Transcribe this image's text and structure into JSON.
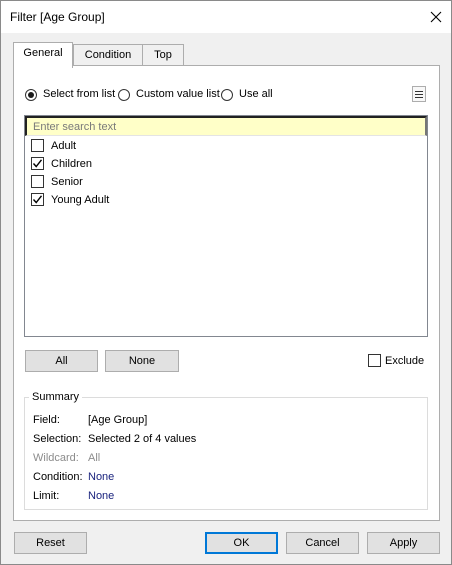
{
  "window": {
    "title": "Filter [Age Group]"
  },
  "tabs": [
    {
      "label": "General",
      "active": true
    },
    {
      "label": "Condition",
      "active": false
    },
    {
      "label": "Top",
      "active": false
    }
  ],
  "mode_options": [
    {
      "label": "Select from list",
      "selected": true
    },
    {
      "label": "Custom value list",
      "selected": false
    },
    {
      "label": "Use all",
      "selected": false
    }
  ],
  "search": {
    "placeholder": "Enter search text",
    "value": ""
  },
  "items": [
    {
      "label": "Adult",
      "checked": false
    },
    {
      "label": "Children",
      "checked": true
    },
    {
      "label": "Senior",
      "checked": false
    },
    {
      "label": "Young Adult",
      "checked": true
    }
  ],
  "list_buttons": {
    "all_label": "All",
    "none_label": "None",
    "exclude_label": "Exclude",
    "exclude_checked": false
  },
  "summary": {
    "title": "Summary",
    "rows": [
      {
        "key": "Field:",
        "value": "[Age Group]"
      },
      {
        "key": "Selection:",
        "value": "Selected 2 of 4 values"
      },
      {
        "key": "Wildcard:",
        "value": "All"
      },
      {
        "key": "Condition:",
        "value": "None"
      },
      {
        "key": "Limit:",
        "value": "None"
      }
    ]
  },
  "footer": {
    "reset_label": "Reset",
    "ok_label": "OK",
    "cancel_label": "Cancel",
    "apply_label": "Apply"
  },
  "colors": {
    "accent": "#0078d7",
    "search_bg": "#ffffc8",
    "link_value": "#1a237e",
    "muted": "#8c8c8c"
  },
  "icons": {
    "close": "close-icon",
    "menu": "menu-icon",
    "check": "check-icon"
  }
}
